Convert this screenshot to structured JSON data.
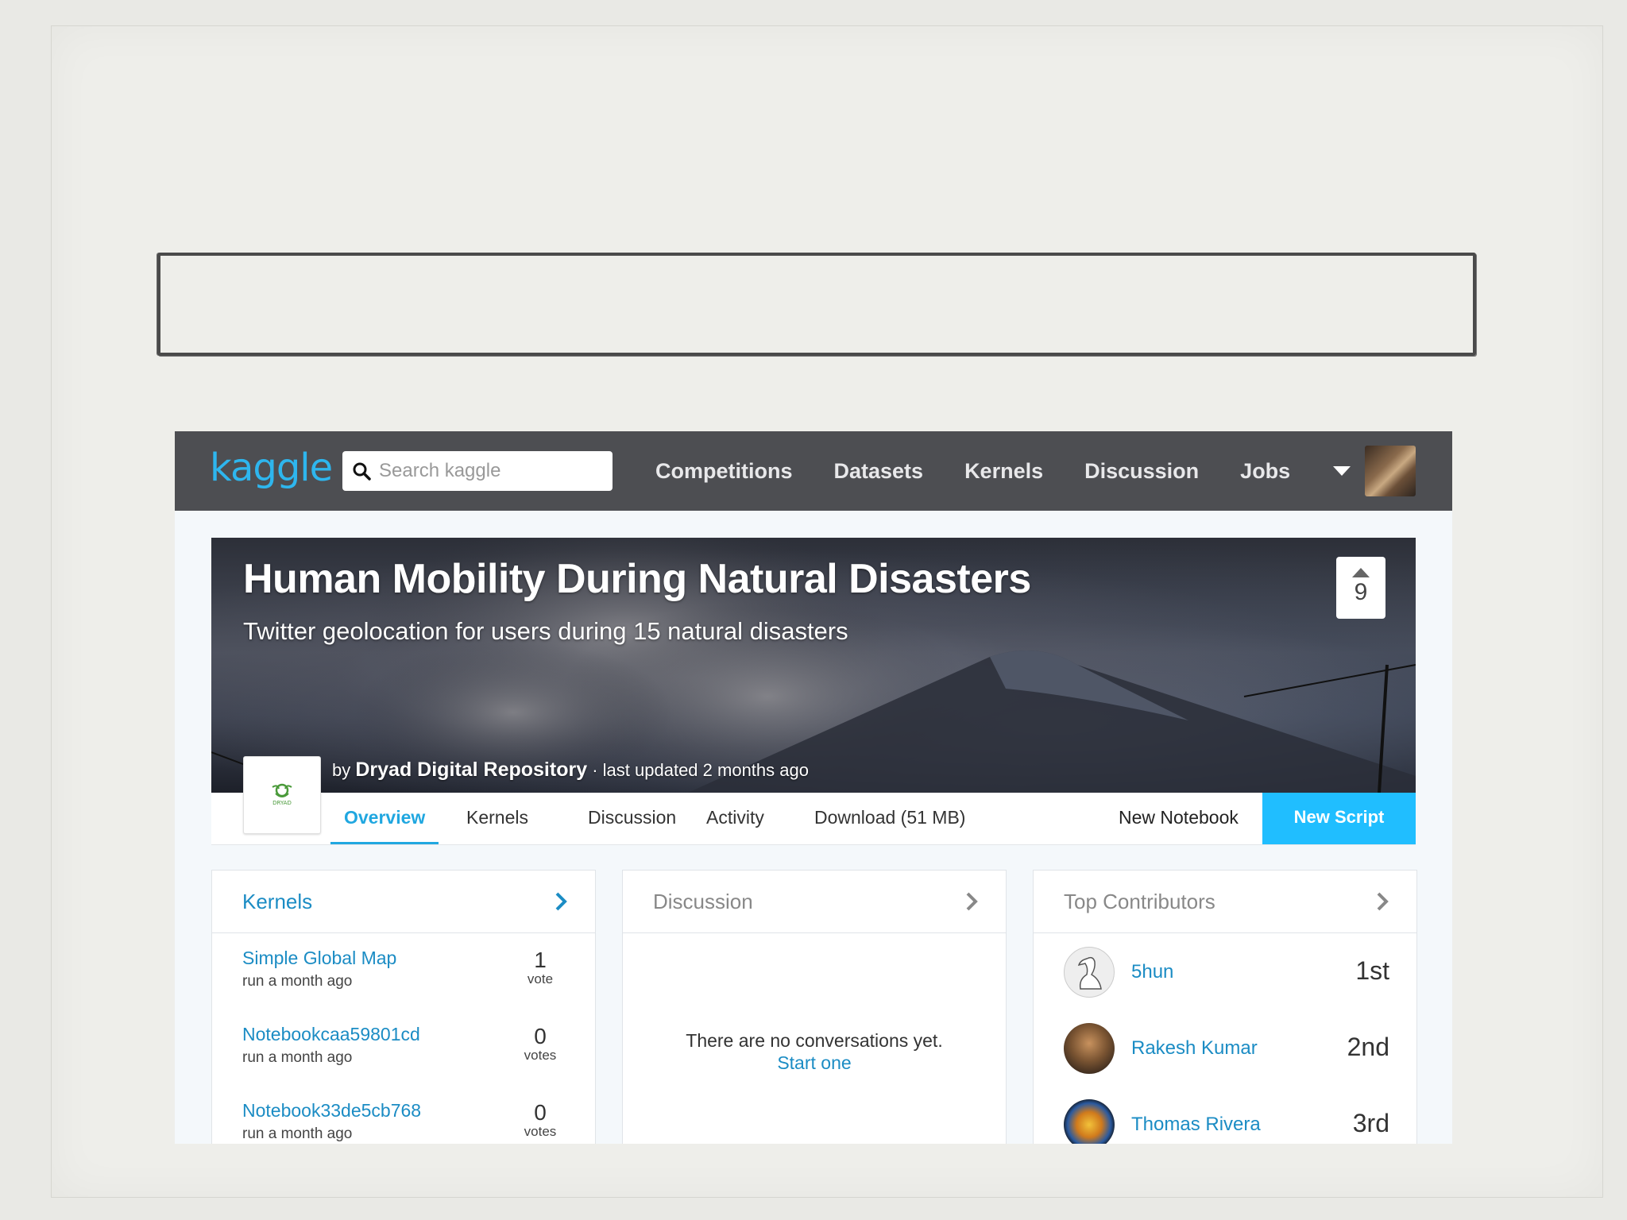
{
  "site": {
    "logo": "kaggle",
    "search_placeholder": "Search kaggle",
    "nav": [
      "Competitions",
      "Datasets",
      "Kernels",
      "Discussion",
      "Jobs"
    ]
  },
  "dataset": {
    "title": "Human Mobility During Natural Disasters",
    "subtitle": "Twitter geolocation for users during 15 natural disasters",
    "upvotes": "9",
    "by_prefix": "by",
    "owner": "Dryad Digital Repository",
    "updated": "· last updated 2 months ago",
    "owner_logo_text": "DRYAD"
  },
  "tabs": {
    "overview": "Overview",
    "kernels": "Kernels",
    "discussion": "Discussion",
    "activity": "Activity",
    "download": "Download (51 MB)",
    "new_notebook": "New Notebook",
    "new_script": "New Script"
  },
  "kernels_card": {
    "title": "Kernels",
    "items": [
      {
        "name": "Simple Global Map",
        "meta": "run a month ago",
        "votes": "1",
        "vote_label": "vote"
      },
      {
        "name": "Notebookcaa59801cd",
        "meta": "run a month ago",
        "votes": "0",
        "vote_label": "votes"
      },
      {
        "name": "Notebook33de5cb768",
        "meta": "run a month ago",
        "votes": "0",
        "vote_label": "votes"
      }
    ]
  },
  "discussion_card": {
    "title": "Discussion",
    "empty_text": "There are no conversations yet.",
    "start_link": "Start one"
  },
  "contributors_card": {
    "title": "Top Contributors",
    "items": [
      {
        "name": "5hun",
        "rank": "1st"
      },
      {
        "name": "Rakesh Kumar",
        "rank": "2nd"
      },
      {
        "name": "Thomas Rivera",
        "rank": "3rd"
      }
    ]
  },
  "colors": {
    "accent": "#20beff",
    "link": "#1b8cc4",
    "topbar": "#4d4e52"
  }
}
